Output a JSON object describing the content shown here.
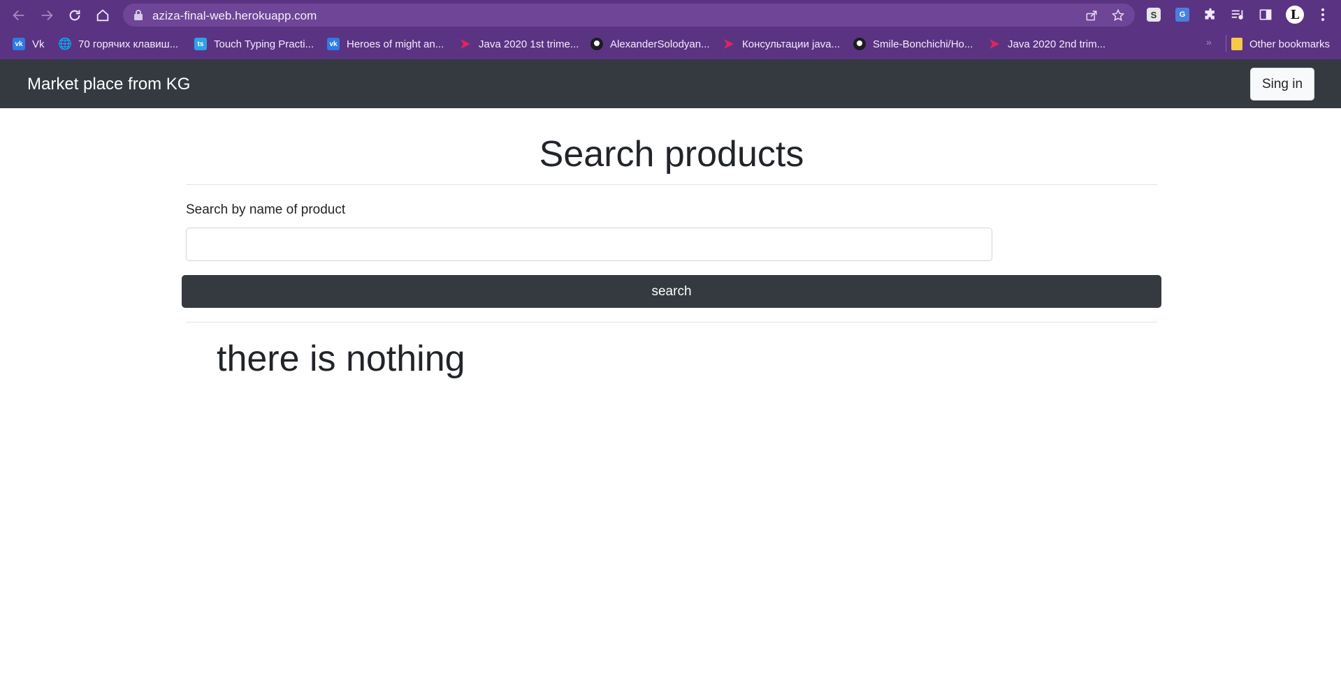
{
  "browser": {
    "url": "aziza-final-web.herokuapp.com",
    "bookmarks": [
      {
        "label": "Vk",
        "icon": "vk-icon"
      },
      {
        "label": "70 горячих клавиш...",
        "icon": "globe-icon"
      },
      {
        "label": "Touch Typing Practi...",
        "icon": "touch-typing-icon"
      },
      {
        "label": "Heroes of might an...",
        "icon": "vk-icon"
      },
      {
        "label": "Java 2020 1st trime...",
        "icon": "java-course-icon"
      },
      {
        "label": "AlexanderSolodyan...",
        "icon": "github-icon"
      },
      {
        "label": "Консультации java...",
        "icon": "java-course-icon"
      },
      {
        "label": "Smile-Bonchichi/Ho...",
        "icon": "github-icon"
      },
      {
        "label": "Java 2020 2nd trim...",
        "icon": "java-course-icon"
      }
    ],
    "other_bookmarks": "Other bookmarks",
    "extensions": {
      "s_label": "S",
      "translate_label": "G",
      "profile_label": "L"
    },
    "colors": {
      "chrome": "#5b3383",
      "omnibox": "#6e4597"
    }
  },
  "navbar": {
    "brand": "Market place from KG",
    "signin_label": "Sing in",
    "color": "#343a40"
  },
  "main": {
    "title": "Search products",
    "search_label": "Search by name of product",
    "search_value": "",
    "search_button": "search",
    "empty_message": "there is nothing"
  }
}
